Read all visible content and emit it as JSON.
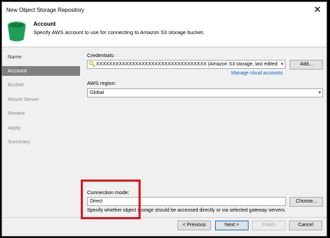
{
  "window": {
    "title": "New Object Storage Repository"
  },
  "header": {
    "title": "Account",
    "subtitle": "Specify AWS account to use for connecting to Amazon S3 storage bucket."
  },
  "sidebar": {
    "items": [
      {
        "label": "Name",
        "state": "normal"
      },
      {
        "label": "Account",
        "state": "active"
      },
      {
        "label": "Bucket",
        "state": "disabled"
      },
      {
        "label": "Mount Server",
        "state": "disabled"
      },
      {
        "label": "Review",
        "state": "disabled"
      },
      {
        "label": "Apply",
        "state": "disabled"
      },
      {
        "label": "Summary",
        "state": "disabled"
      }
    ]
  },
  "credentials": {
    "label": "Credentials:",
    "value": "XXXXXXXXXXXXXXXXXXXXXXXXXXXXXXXXXX (Amazon S3 storage, last edited:",
    "add_label": "Add...",
    "manage_link": "Manage cloud accounts"
  },
  "region": {
    "label": "AWS region:",
    "value": "Global"
  },
  "connection": {
    "label": "Connection mode:",
    "value": "Direct",
    "choose_label": "Choose...",
    "hint": "Specify whether object storage should be accessed directly or via selected gateway servers."
  },
  "footer": {
    "previous_label": "< Previous",
    "next_label": "Next >",
    "finish_label": "Finish",
    "cancel_label": "Cancel"
  },
  "colors": {
    "highlight_box": "#e0121b",
    "bucket_icon": "#1f9f55",
    "sidebar_active": "#808080",
    "link": "#0066cc"
  },
  "icons": [
    "close-icon",
    "bucket-icon",
    "key-icon",
    "chevron-down-icon"
  ]
}
